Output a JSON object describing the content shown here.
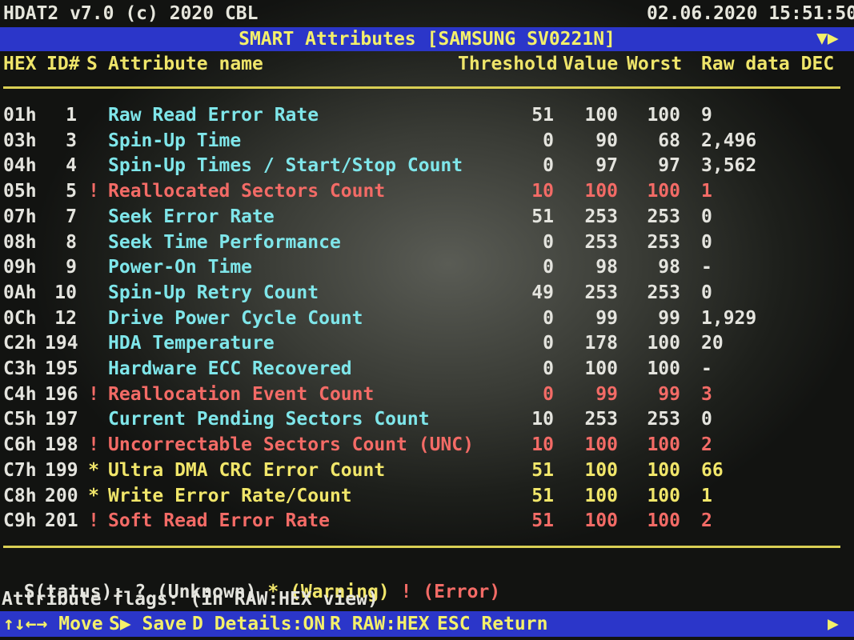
{
  "header": {
    "app_title": "HDAT2 v7.0 (c) 2020 CBL",
    "datetime": "02.06.2020 15:51:50"
  },
  "title_bar": {
    "title": "SMART Attributes [SAMSUNG SV0221N]",
    "scroll_indicator": "▼▶"
  },
  "columns": {
    "hex": "HEX",
    "id": "ID#",
    "status": "S",
    "name": "Attribute name",
    "threshold": "Threshold",
    "value": "Value",
    "worst": "Worst",
    "raw": "Raw data DEC"
  },
  "attributes": [
    {
      "hex": "01h",
      "id": "1",
      "status": "",
      "name": "Raw Read Error Rate",
      "threshold": "51",
      "value": "100",
      "worst": "100",
      "raw": "9",
      "level": "ok"
    },
    {
      "hex": "03h",
      "id": "3",
      "status": "",
      "name": "Spin-Up Time",
      "threshold": "0",
      "value": "90",
      "worst": "68",
      "raw": "2,496",
      "level": "ok"
    },
    {
      "hex": "04h",
      "id": "4",
      "status": "",
      "name": "Spin-Up Times / Start/Stop Count",
      "threshold": "0",
      "value": "97",
      "worst": "97",
      "raw": "3,562",
      "level": "ok"
    },
    {
      "hex": "05h",
      "id": "5",
      "status": "!",
      "name": "Reallocated Sectors Count",
      "threshold": "10",
      "value": "100",
      "worst": "100",
      "raw": "1",
      "level": "error"
    },
    {
      "hex": "07h",
      "id": "7",
      "status": "",
      "name": "Seek Error Rate",
      "threshold": "51",
      "value": "253",
      "worst": "253",
      "raw": "0",
      "level": "ok"
    },
    {
      "hex": "08h",
      "id": "8",
      "status": "",
      "name": "Seek Time Performance",
      "threshold": "0",
      "value": "253",
      "worst": "253",
      "raw": "0",
      "level": "ok"
    },
    {
      "hex": "09h",
      "id": "9",
      "status": "",
      "name": "Power-On Time",
      "threshold": "0",
      "value": "98",
      "worst": "98",
      "raw": "-",
      "level": "ok"
    },
    {
      "hex": "0Ah",
      "id": "10",
      "status": "",
      "name": "Spin-Up Retry Count",
      "threshold": "49",
      "value": "253",
      "worst": "253",
      "raw": "0",
      "level": "ok"
    },
    {
      "hex": "0Ch",
      "id": "12",
      "status": "",
      "name": "Drive Power Cycle Count",
      "threshold": "0",
      "value": "99",
      "worst": "99",
      "raw": "1,929",
      "level": "ok"
    },
    {
      "hex": "C2h",
      "id": "194",
      "status": "",
      "name": "HDA Temperature",
      "threshold": "0",
      "value": "178",
      "worst": "100",
      "raw": "20",
      "level": "ok"
    },
    {
      "hex": "C3h",
      "id": "195",
      "status": "",
      "name": "Hardware ECC Recovered",
      "threshold": "0",
      "value": "100",
      "worst": "100",
      "raw": "-",
      "level": "ok"
    },
    {
      "hex": "C4h",
      "id": "196",
      "status": "!",
      "name": "Reallocation Event Count",
      "threshold": "0",
      "value": "99",
      "worst": "99",
      "raw": "3",
      "level": "error"
    },
    {
      "hex": "C5h",
      "id": "197",
      "status": "",
      "name": "Current Pending Sectors Count",
      "threshold": "10",
      "value": "253",
      "worst": "253",
      "raw": "0",
      "level": "ok"
    },
    {
      "hex": "C6h",
      "id": "198",
      "status": "!",
      "name": "Uncorrectable Sectors Count (UNC)",
      "threshold": "10",
      "value": "100",
      "worst": "100",
      "raw": "2",
      "level": "error"
    },
    {
      "hex": "C7h",
      "id": "199",
      "status": "*",
      "name": "Ultra DMA CRC Error Count",
      "threshold": "51",
      "value": "100",
      "worst": "100",
      "raw": "66",
      "level": "warning"
    },
    {
      "hex": "C8h",
      "id": "200",
      "status": "*",
      "name": "Write Error Rate/Count",
      "threshold": "51",
      "value": "100",
      "worst": "100",
      "raw": "1",
      "level": "warning"
    },
    {
      "hex": "C9h",
      "id": "201",
      "status": "!",
      "name": "Soft Read Error Rate",
      "threshold": "51",
      "value": "100",
      "worst": "100",
      "raw": "2",
      "level": "error"
    }
  ],
  "legend": {
    "prefix": "S(tatus): ",
    "unknown": "? (Unknown)",
    "warning": "* (Warning)",
    "error": "! (Error)"
  },
  "flags_line": "Attribute flags: (in RAW:HEX view)",
  "bottom_bar": {
    "move": "↑↓←→ Move",
    "save": "S▶ Save",
    "details": "D Details:ON",
    "raw": "R RAW:HEX",
    "esc": "ESC Return",
    "arrow": "▶"
  },
  "colors": {
    "bar_bg": "#2b36c9",
    "header_yellow": "#efe56a",
    "name_cyan": "#7fe6ea",
    "value_white": "#e4e4de",
    "warning": "#f1e66a",
    "error": "#f36b66"
  }
}
